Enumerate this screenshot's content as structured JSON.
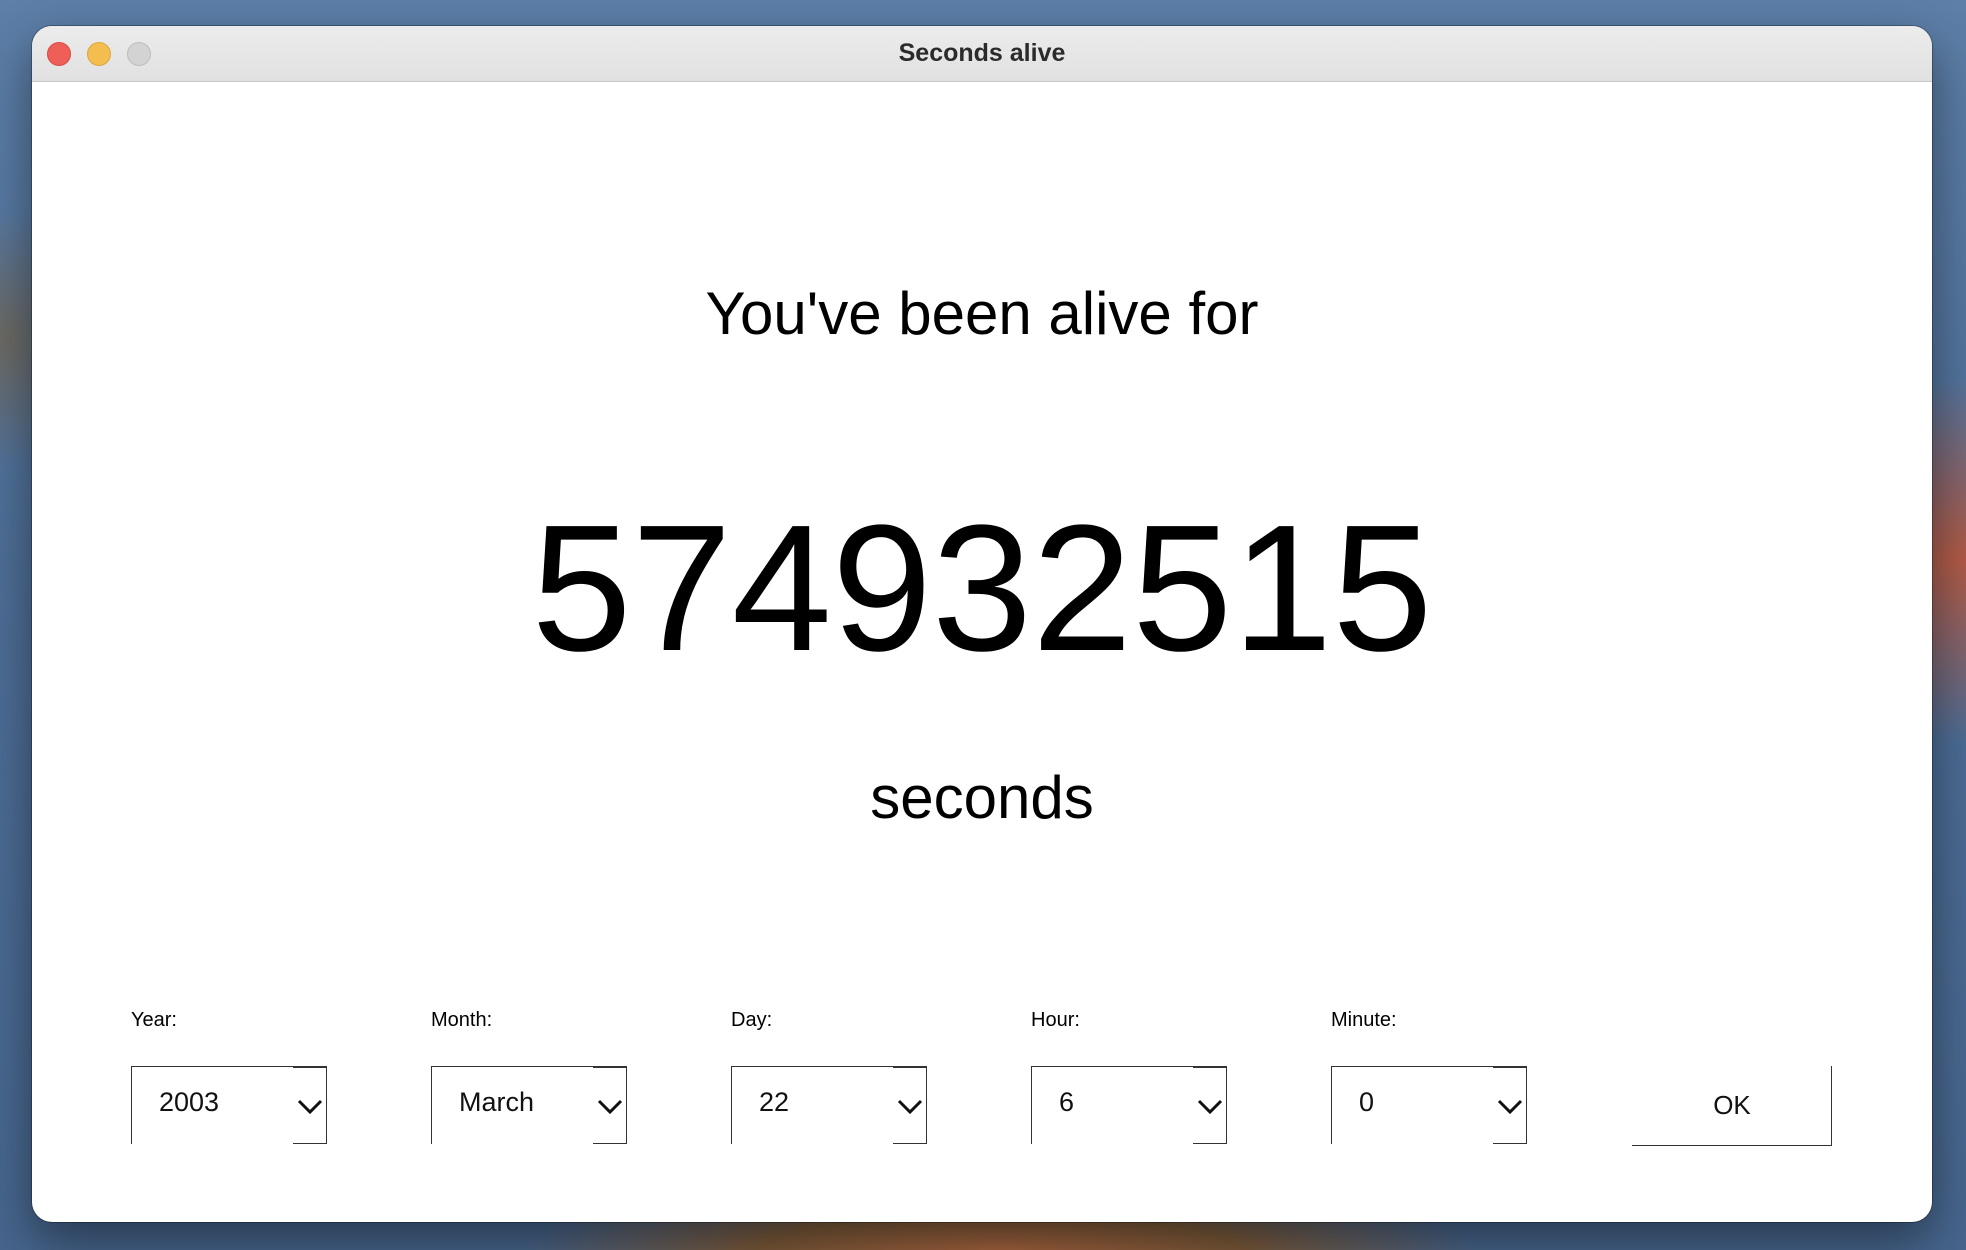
{
  "window": {
    "title": "Seconds alive"
  },
  "main": {
    "headline": "You've been alive for",
    "seconds_value": "574932515",
    "unit": "seconds"
  },
  "fields": {
    "year": {
      "label": "Year:",
      "value": "2003"
    },
    "month": {
      "label": "Month:",
      "value": "March"
    },
    "day": {
      "label": "Day:",
      "value": "22"
    },
    "hour": {
      "label": "Hour:",
      "value": "6"
    },
    "minute": {
      "label": "Minute:",
      "value": "0"
    }
  },
  "ok_button": {
    "label": "OK"
  },
  "icons": {
    "dropdown": "chevron-down-icon",
    "close": "close-icon",
    "minimize": "minimize-icon",
    "zoom": "zoom-icon"
  },
  "colors": {
    "close": "#ee5f57",
    "minimize": "#f4bd4f",
    "zoom_disabled": "#d3d3d3"
  }
}
